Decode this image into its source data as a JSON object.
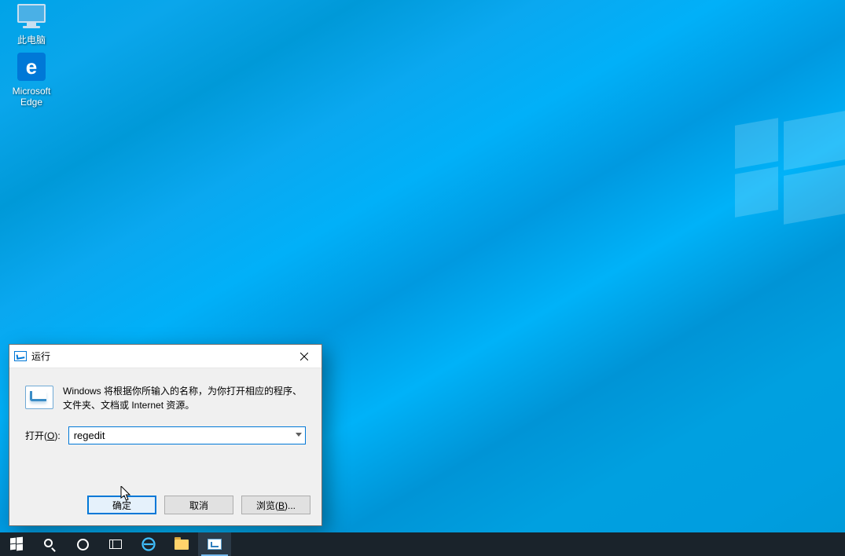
{
  "desktop": {
    "icons": [
      {
        "name": "this-pc",
        "label": "此电脑"
      },
      {
        "name": "ms-edge",
        "label": "Microsoft Edge"
      }
    ]
  },
  "run_dialog": {
    "title": "运行",
    "description": "Windows 将根据你所输入的名称，为你打开相应的程序、文件夹、文档或 Internet 资源。",
    "open_label_pre": "打开(",
    "open_label_u": "O",
    "open_label_post": "):",
    "value": "regedit",
    "buttons": {
      "ok": "确定",
      "cancel": "取消",
      "browse_pre": "浏览(",
      "browse_u": "B",
      "browse_post": ")..."
    }
  },
  "taskbar": {
    "items": [
      {
        "name": "start-button",
        "icon": "start-flag"
      },
      {
        "name": "search-button",
        "icon": "magnifier"
      },
      {
        "name": "cortana-button",
        "icon": "cortana-ring"
      },
      {
        "name": "taskview-button",
        "icon": "task-view"
      },
      {
        "name": "edge-taskbar",
        "icon": "edge"
      },
      {
        "name": "explorer-taskbar",
        "icon": "folder"
      },
      {
        "name": "run-taskbar",
        "icon": "run",
        "active": true
      }
    ]
  }
}
